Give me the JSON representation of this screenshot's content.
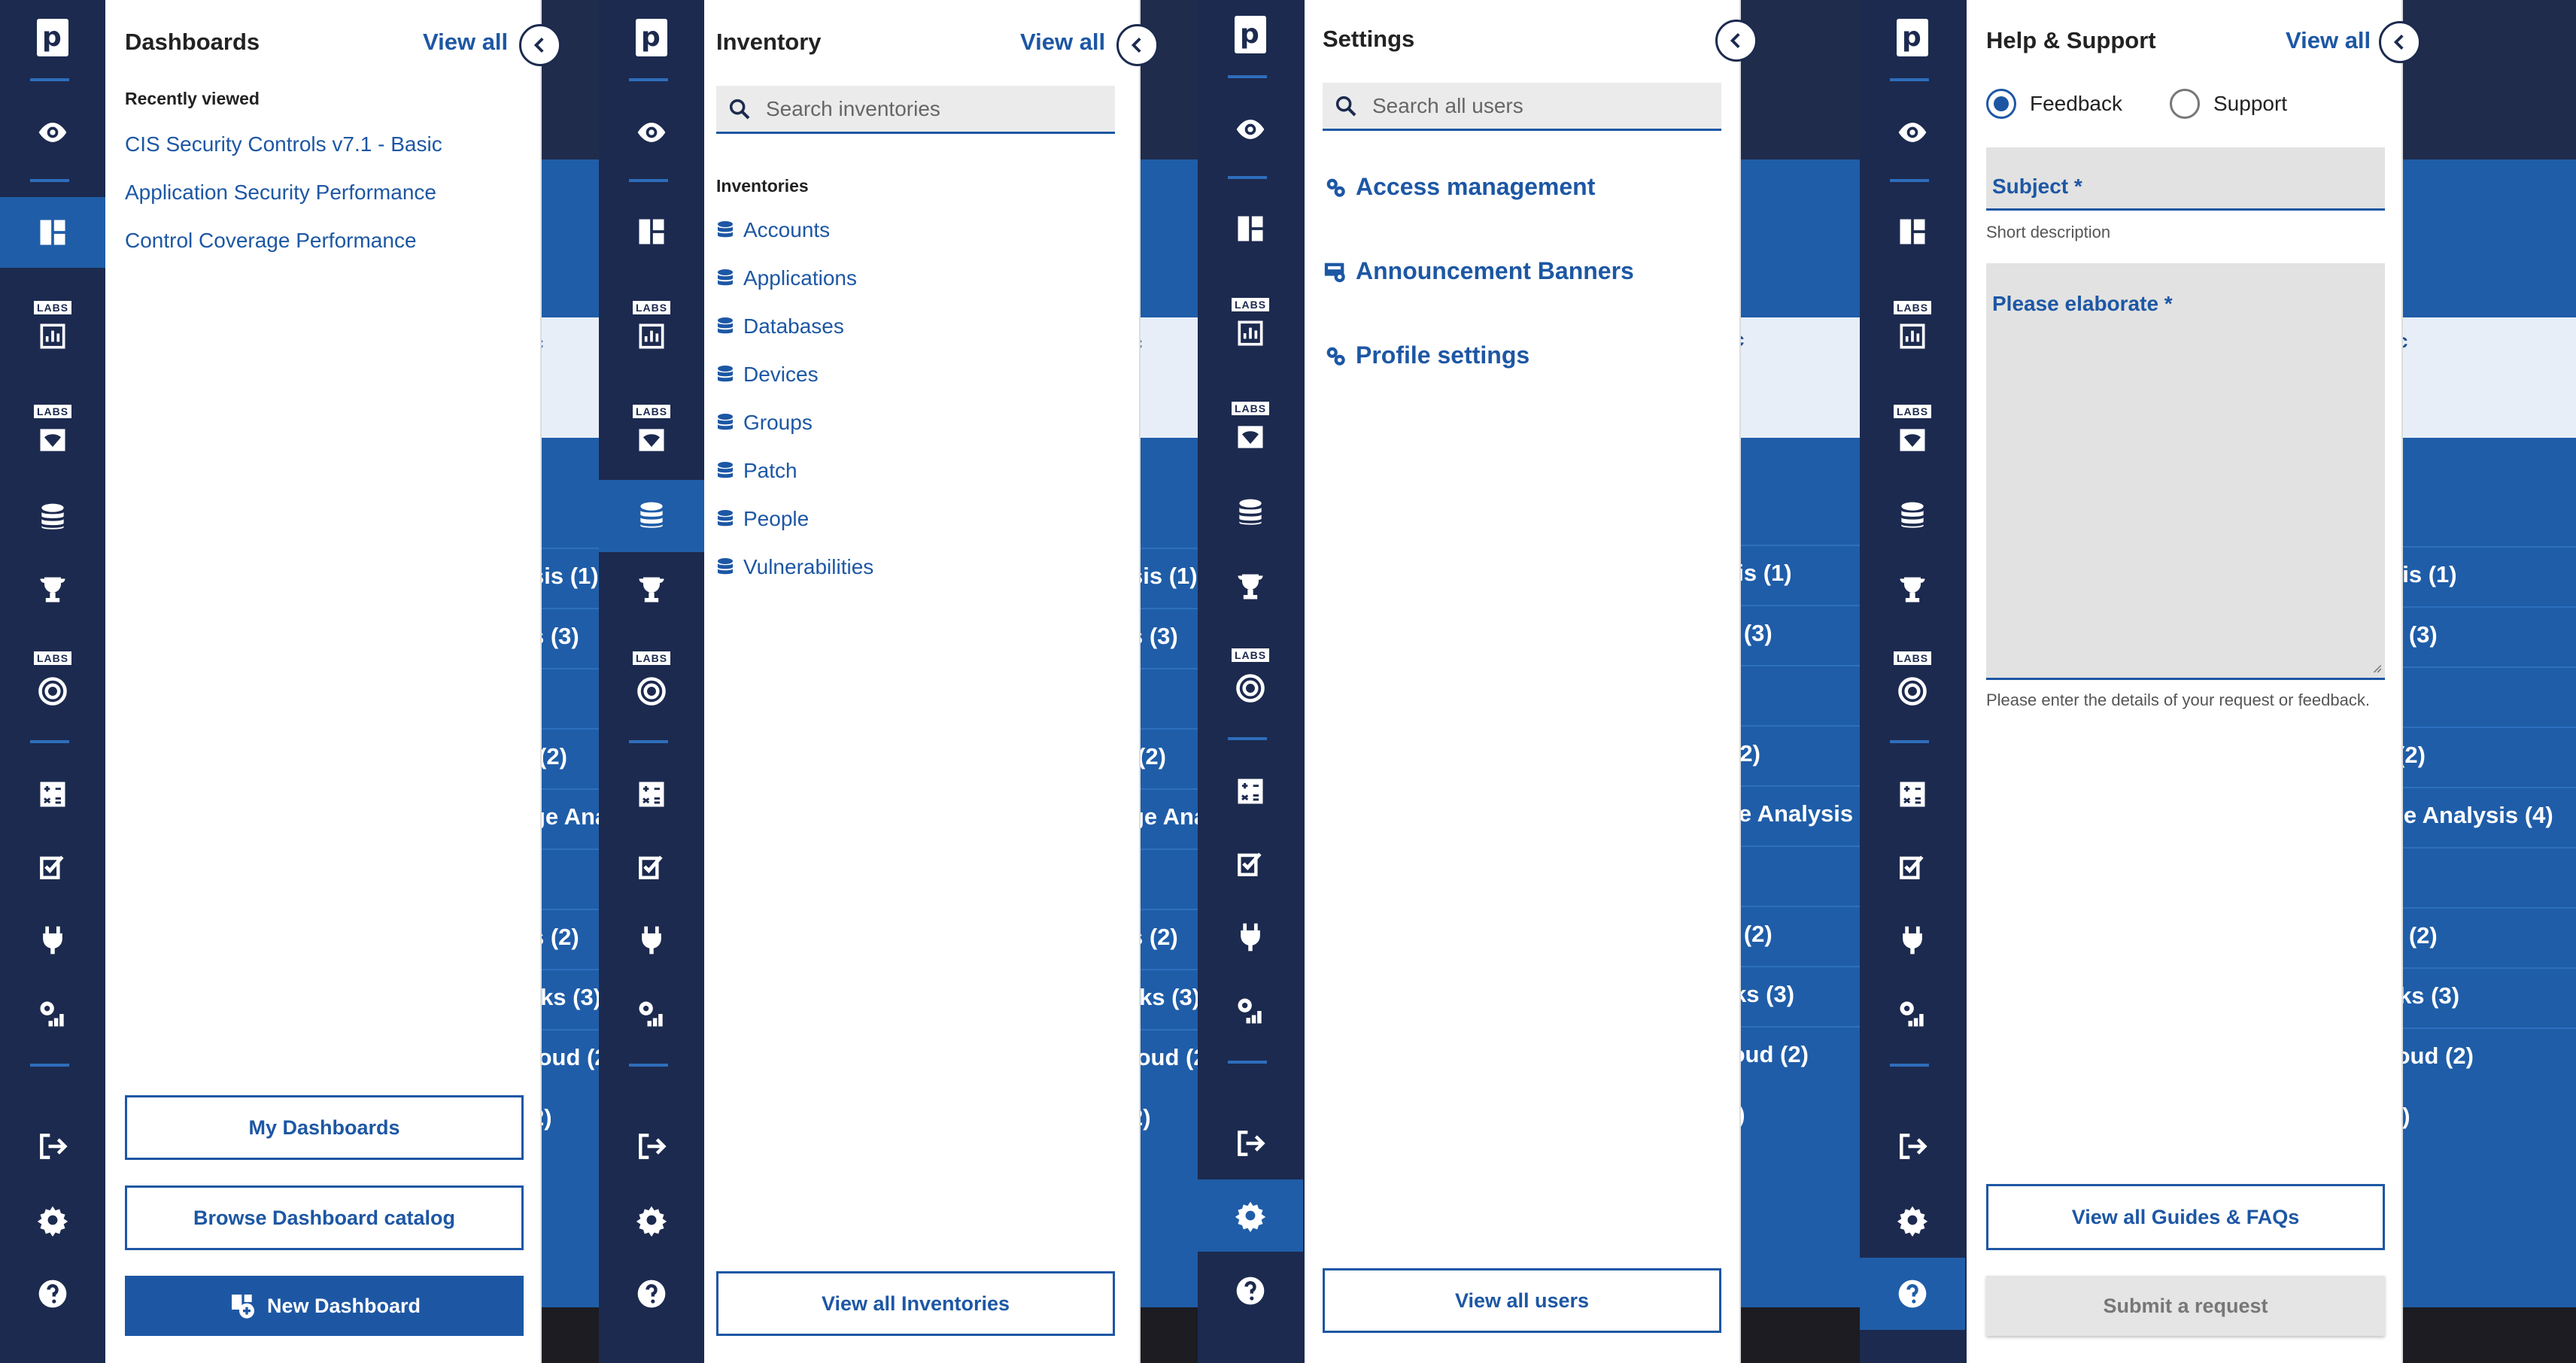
{
  "rail": {
    "logo_letter": "p",
    "labs_label": "LABS"
  },
  "background": {
    "rows": [
      "sis (1)",
      "s (3)",
      "(2)",
      "ge Analysis (4)",
      "s (2)",
      "rks (3)",
      "loud (2)",
      "2)"
    ],
    "card_text": "c"
  },
  "dashboards": {
    "title": "Dashboards",
    "view_all": "View all",
    "recently_viewed_label": "Recently viewed",
    "recent": [
      "CIS Security Controls v7.1 - Basic",
      "Application Security Performance",
      "Control Coverage Performance"
    ],
    "my_dashboards": "My Dashboards",
    "browse_catalog": "Browse Dashboard catalog",
    "new_dashboard": "New Dashboard"
  },
  "inventory": {
    "title": "Inventory",
    "view_all": "View all",
    "search_placeholder": "Search inventories",
    "section_label": "Inventories",
    "items": [
      "Accounts",
      "Applications",
      "Databases",
      "Devices",
      "Groups",
      "Patch",
      "People",
      "Vulnerabilities"
    ],
    "view_all_button": "View all Inventories"
  },
  "settings": {
    "title": "Settings",
    "search_placeholder": "Search all users",
    "links": [
      "Access management",
      "Announcement Banners",
      "Profile settings"
    ],
    "view_all_button": "View all users"
  },
  "help": {
    "title": "Help & Support",
    "view_all": "View all",
    "radio_feedback": "Feedback",
    "radio_support": "Support",
    "subject_label": "Subject *",
    "subject_hint": "Short description",
    "elaborate_label": "Please elaborate *",
    "elaborate_hint": "Please enter the details of your request or feedback.",
    "guides_button": "View all Guides & FAQs",
    "submit_button": "Submit a request"
  },
  "colors": {
    "rail": "#1c2a4f",
    "accent": "#1d57a4",
    "active": "#1f5da8"
  }
}
